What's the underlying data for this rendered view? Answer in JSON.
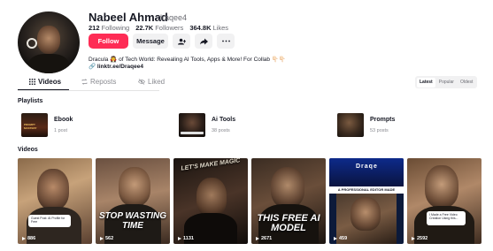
{
  "profile": {
    "name": "Nabeel Ahmad",
    "handle": "draqee4",
    "following_count": "212",
    "following_label": "Following",
    "followers_count": "22.7K",
    "followers_label": "Followers",
    "likes_count": "364.8K",
    "likes_label": "Likes",
    "bio": "Dracula 🧛 of Tech World: Revealing AI Tools, Apps & More! For Collab 👇🏻👇🏻",
    "link": "linktr.ee/Draqee4"
  },
  "actions": {
    "follow_label": "Follow",
    "message_label": "Message",
    "add_friend_icon": "person-add-icon",
    "share_icon": "share-icon",
    "more_icon": "more-horizontal-icon"
  },
  "tabs": [
    {
      "label": "Videos",
      "icon": "grid-icon"
    },
    {
      "label": "Reposts",
      "icon": "repost-icon"
    },
    {
      "label": "Liked",
      "icon": "eye-off-icon"
    }
  ],
  "sort": {
    "options": [
      "Latest",
      "Popular",
      "Oldest"
    ],
    "selected": "Latest"
  },
  "playlists_heading": "Playlists",
  "playlists": [
    {
      "title": "Ebook",
      "count": "1 post"
    },
    {
      "title": "Ai Tools",
      "count": "38 posts"
    },
    {
      "title": "Prompts",
      "count": "53 posts"
    }
  ],
  "videos_heading": "Videos",
  "videos": [
    {
      "views": "886",
      "card_text": "Guest Post: AI Profile for Free"
    },
    {
      "views": "562",
      "overlay": "STOP WASTING TIME"
    },
    {
      "views": "1131",
      "overlay": "LET'S MAKE MAGIC"
    },
    {
      "views": "2671",
      "overlay": "THIS FREE AI MODEL"
    },
    {
      "views": "459",
      "banner": "A PROFESSIONAL EDITOR MADE"
    },
    {
      "views": "2592",
      "card_text": "I Made a Free Video Creation Using this..."
    }
  ],
  "colors": {
    "accent": "#fe2c55",
    "text": "#161823",
    "muted": "#6b6c73"
  }
}
